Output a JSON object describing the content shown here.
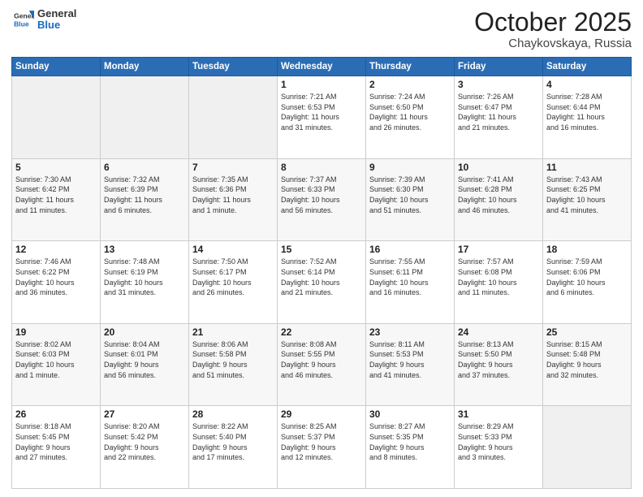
{
  "header": {
    "logo_general": "General",
    "logo_blue": "Blue",
    "month": "October 2025",
    "location": "Chaykovskaya, Russia"
  },
  "days_of_week": [
    "Sunday",
    "Monday",
    "Tuesday",
    "Wednesday",
    "Thursday",
    "Friday",
    "Saturday"
  ],
  "weeks": [
    [
      {
        "day": "",
        "info": ""
      },
      {
        "day": "",
        "info": ""
      },
      {
        "day": "",
        "info": ""
      },
      {
        "day": "1",
        "info": "Sunrise: 7:21 AM\nSunset: 6:53 PM\nDaylight: 11 hours\nand 31 minutes."
      },
      {
        "day": "2",
        "info": "Sunrise: 7:24 AM\nSunset: 6:50 PM\nDaylight: 11 hours\nand 26 minutes."
      },
      {
        "day": "3",
        "info": "Sunrise: 7:26 AM\nSunset: 6:47 PM\nDaylight: 11 hours\nand 21 minutes."
      },
      {
        "day": "4",
        "info": "Sunrise: 7:28 AM\nSunset: 6:44 PM\nDaylight: 11 hours\nand 16 minutes."
      }
    ],
    [
      {
        "day": "5",
        "info": "Sunrise: 7:30 AM\nSunset: 6:42 PM\nDaylight: 11 hours\nand 11 minutes."
      },
      {
        "day": "6",
        "info": "Sunrise: 7:32 AM\nSunset: 6:39 PM\nDaylight: 11 hours\nand 6 minutes."
      },
      {
        "day": "7",
        "info": "Sunrise: 7:35 AM\nSunset: 6:36 PM\nDaylight: 11 hours\nand 1 minute."
      },
      {
        "day": "8",
        "info": "Sunrise: 7:37 AM\nSunset: 6:33 PM\nDaylight: 10 hours\nand 56 minutes."
      },
      {
        "day": "9",
        "info": "Sunrise: 7:39 AM\nSunset: 6:30 PM\nDaylight: 10 hours\nand 51 minutes."
      },
      {
        "day": "10",
        "info": "Sunrise: 7:41 AM\nSunset: 6:28 PM\nDaylight: 10 hours\nand 46 minutes."
      },
      {
        "day": "11",
        "info": "Sunrise: 7:43 AM\nSunset: 6:25 PM\nDaylight: 10 hours\nand 41 minutes."
      }
    ],
    [
      {
        "day": "12",
        "info": "Sunrise: 7:46 AM\nSunset: 6:22 PM\nDaylight: 10 hours\nand 36 minutes."
      },
      {
        "day": "13",
        "info": "Sunrise: 7:48 AM\nSunset: 6:19 PM\nDaylight: 10 hours\nand 31 minutes."
      },
      {
        "day": "14",
        "info": "Sunrise: 7:50 AM\nSunset: 6:17 PM\nDaylight: 10 hours\nand 26 minutes."
      },
      {
        "day": "15",
        "info": "Sunrise: 7:52 AM\nSunset: 6:14 PM\nDaylight: 10 hours\nand 21 minutes."
      },
      {
        "day": "16",
        "info": "Sunrise: 7:55 AM\nSunset: 6:11 PM\nDaylight: 10 hours\nand 16 minutes."
      },
      {
        "day": "17",
        "info": "Sunrise: 7:57 AM\nSunset: 6:08 PM\nDaylight: 10 hours\nand 11 minutes."
      },
      {
        "day": "18",
        "info": "Sunrise: 7:59 AM\nSunset: 6:06 PM\nDaylight: 10 hours\nand 6 minutes."
      }
    ],
    [
      {
        "day": "19",
        "info": "Sunrise: 8:02 AM\nSunset: 6:03 PM\nDaylight: 10 hours\nand 1 minute."
      },
      {
        "day": "20",
        "info": "Sunrise: 8:04 AM\nSunset: 6:01 PM\nDaylight: 9 hours\nand 56 minutes."
      },
      {
        "day": "21",
        "info": "Sunrise: 8:06 AM\nSunset: 5:58 PM\nDaylight: 9 hours\nand 51 minutes."
      },
      {
        "day": "22",
        "info": "Sunrise: 8:08 AM\nSunset: 5:55 PM\nDaylight: 9 hours\nand 46 minutes."
      },
      {
        "day": "23",
        "info": "Sunrise: 8:11 AM\nSunset: 5:53 PM\nDaylight: 9 hours\nand 41 minutes."
      },
      {
        "day": "24",
        "info": "Sunrise: 8:13 AM\nSunset: 5:50 PM\nDaylight: 9 hours\nand 37 minutes."
      },
      {
        "day": "25",
        "info": "Sunrise: 8:15 AM\nSunset: 5:48 PM\nDaylight: 9 hours\nand 32 minutes."
      }
    ],
    [
      {
        "day": "26",
        "info": "Sunrise: 8:18 AM\nSunset: 5:45 PM\nDaylight: 9 hours\nand 27 minutes."
      },
      {
        "day": "27",
        "info": "Sunrise: 8:20 AM\nSunset: 5:42 PM\nDaylight: 9 hours\nand 22 minutes."
      },
      {
        "day": "28",
        "info": "Sunrise: 8:22 AM\nSunset: 5:40 PM\nDaylight: 9 hours\nand 17 minutes."
      },
      {
        "day": "29",
        "info": "Sunrise: 8:25 AM\nSunset: 5:37 PM\nDaylight: 9 hours\nand 12 minutes."
      },
      {
        "day": "30",
        "info": "Sunrise: 8:27 AM\nSunset: 5:35 PM\nDaylight: 9 hours\nand 8 minutes."
      },
      {
        "day": "31",
        "info": "Sunrise: 8:29 AM\nSunset: 5:33 PM\nDaylight: 9 hours\nand 3 minutes."
      },
      {
        "day": "",
        "info": ""
      }
    ]
  ]
}
